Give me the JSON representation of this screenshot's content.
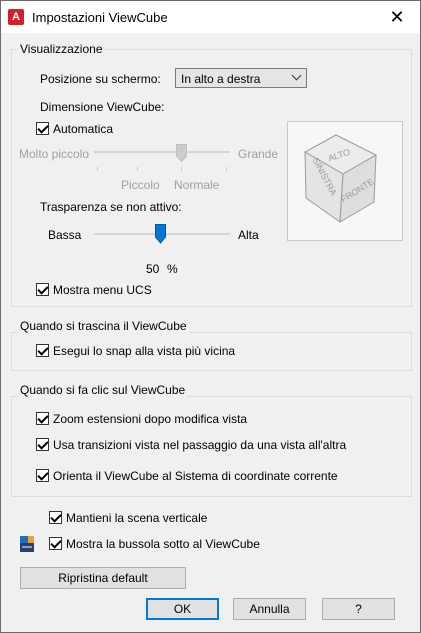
{
  "window": {
    "title": "Impostazioni ViewCube",
    "app_icon_letter": "A"
  },
  "display_group": {
    "legend": "Visualizzazione",
    "screen_position_label": "Posizione su schermo:",
    "screen_position_value": "In alto a destra",
    "size_label": "Dimensione ViewCube:",
    "automatic_label": "Automatica",
    "automatic_checked": true,
    "size_min_label": "Molto piccolo",
    "size_max_label": "Grande",
    "size_tick_small": "Piccolo",
    "size_tick_normal": "Normale",
    "transparency_label": "Trasparenza se non attivo:",
    "transparency_low": "Bassa",
    "transparency_high": "Alta",
    "transparency_value": "50",
    "transparency_unit": "%",
    "show_ucs_menu_label": "Mostra menu UCS",
    "show_ucs_menu_checked": true
  },
  "cube_preview": {
    "top_face": "ALTO",
    "left_face": "SINISTRA",
    "right_face": "FRONTE"
  },
  "drag_group": {
    "legend": "Quando si trascina il ViewCube",
    "snap_label": "Esegui lo snap alla vista più vicina",
    "snap_checked": true
  },
  "click_group": {
    "legend": "Quando si fa clic sul ViewCube",
    "zoom_extents_label": "Zoom estensioni dopo modifica vista",
    "transitions_label": "Usa transizioni vista nel passaggio da una vista all'altra",
    "orient_label": "Orienta il ViewCube al Sistema di coordinate corrente"
  },
  "keep_upright_label": "Mantieni la scena verticale",
  "show_compass_label": "Mostra la bussola sotto al ViewCube",
  "buttons": {
    "restore": "Ripristina default",
    "ok": "OK",
    "cancel": "Annulla",
    "help": "?"
  },
  "colors": {
    "accent": "#0078d7",
    "app_icon": "#d4202a"
  }
}
